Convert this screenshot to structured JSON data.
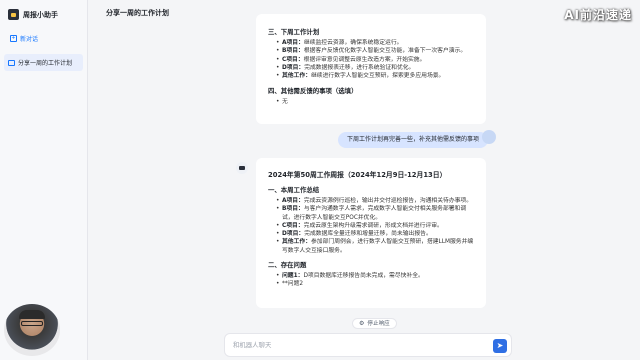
{
  "app": {
    "title": "周报小助手",
    "logo_icon": "robot-logo-icon"
  },
  "sidebar": {
    "new_chat_label": "新对话",
    "conversations": [
      {
        "label": "分享一周的工作计划"
      }
    ]
  },
  "header": {
    "title": "分享一周的工作计划",
    "watermark": "AI前沿速递"
  },
  "message1": {
    "sections": [
      {
        "heading": "三、下周工作计划",
        "items": [
          {
            "key": "A项目：",
            "text": "继续监控云资源，确保系统稳定运行。"
          },
          {
            "key": "B项目：",
            "text": "根据客户反馈优化数字人智能交互功能，准备下一次客户演示。"
          },
          {
            "key": "C项目：",
            "text": "根据评审意见调整云原生改造方案，开始实施。"
          },
          {
            "key": "D项目：",
            "text": "完成数据报表迁移，进行系统验证和优化。"
          },
          {
            "key": "其他工作：",
            "text": "继续进行数字人智能交互预研，探索更多应用场景。"
          }
        ]
      },
      {
        "heading": "四、其他需反馈的事项（选填）",
        "items": [
          {
            "key": "",
            "text": "无"
          }
        ]
      }
    ]
  },
  "user_message": {
    "text": "下周工作计划再完善一些，补充其他需反馈的事项"
  },
  "message2": {
    "title": "2024年第50周工作周报（2024年12月9日-12月13日）",
    "sections": [
      {
        "heading": "一、本周工作总结",
        "items": [
          {
            "key": "A项目：",
            "text": "完成云资源例行巡检，输出并交付巡检报告，沟通相关待办事项。"
          },
          {
            "key": "B项目：",
            "text": "与客户沟通数字人需求，完成数字人智能交付相关服务部署和调试，进行数字人智能交互POC并优化。"
          },
          {
            "key": "C项目：",
            "text": "完成云原生架构升级需求调研，形成文档并进行评审。"
          },
          {
            "key": "D项目：",
            "text": "完成数据库全量迁移和增量迁移，尚未输出报告。"
          },
          {
            "key": "其他工作：",
            "text": "参加部门周例会，进行数字人智能交互预研，搭建LLM服务并编写数字人交互接口服务。"
          }
        ]
      },
      {
        "heading": "二、存在问题",
        "items": [
          {
            "key": "问题1：",
            "text": "D项目数据库迁移报告尚未完成，需尽快补全。"
          },
          {
            "key": "",
            "text": "**问题2"
          }
        ]
      }
    ]
  },
  "controls": {
    "stop_label": "停止响应",
    "input_placeholder": "和机器人聊天",
    "send_icon": "send-icon"
  },
  "colors": {
    "accent": "#1677ff",
    "user_bubble": "#d7e4ff",
    "send": "#2f6fe4"
  }
}
